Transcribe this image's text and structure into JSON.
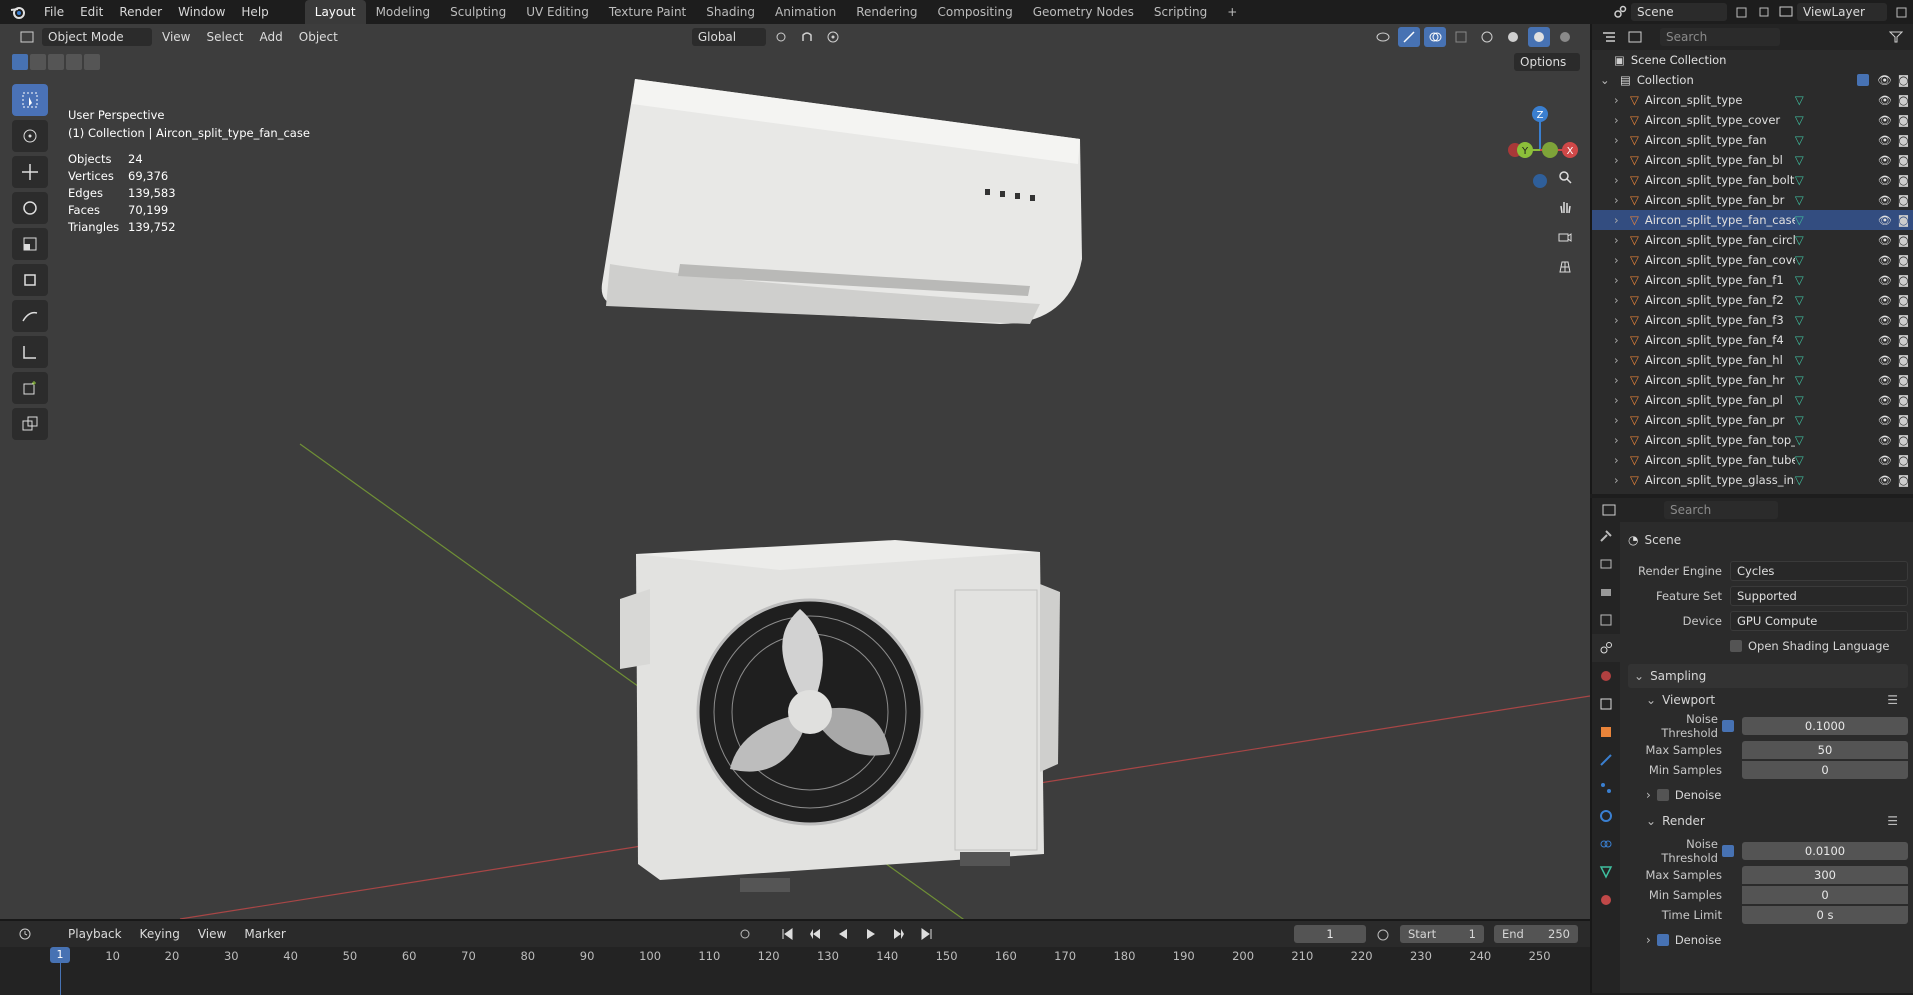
{
  "topbar": {
    "menus": [
      "File",
      "Edit",
      "Render",
      "Window",
      "Help"
    ],
    "workspaces": [
      "Layout",
      "Modeling",
      "Sculpting",
      "UV Editing",
      "Texture Paint",
      "Shading",
      "Animation",
      "Rendering",
      "Compositing",
      "Geometry Nodes",
      "Scripting"
    ],
    "active_workspace": "Layout",
    "add_tab": "+",
    "scene_name": "Scene",
    "view_layer": "ViewLayer"
  },
  "viewport": {
    "mode": "Object Mode",
    "menus": [
      "View",
      "Select",
      "Add",
      "Object"
    ],
    "transform_orientation": "Global",
    "options_label": "Options",
    "overlay_title": "User Perspective",
    "overlay_subtitle": "(1) Collection | Aircon_split_type_fan_case",
    "stats": [
      {
        "label": "Objects",
        "value": "24"
      },
      {
        "label": "Vertices",
        "value": "69,376"
      },
      {
        "label": "Edges",
        "value": "139,583"
      },
      {
        "label": "Faces",
        "value": "70,199"
      },
      {
        "label": "Triangles",
        "value": "139,752"
      }
    ],
    "gizmo": {
      "z": "Z",
      "y": "Y",
      "x": "X"
    }
  },
  "outliner": {
    "search_placeholder": "Search",
    "scene_collection": "Scene Collection",
    "collection": "Collection",
    "objects": [
      "Aircon_split_type",
      "Aircon_split_type_cover",
      "Aircon_split_type_fan",
      "Aircon_split_type_fan_bl",
      "Aircon_split_type_fan_bolts",
      "Aircon_split_type_fan_br",
      "Aircon_split_type_fan_case",
      "Aircon_split_type_fan_circle",
      "Aircon_split_type_fan_cover",
      "Aircon_split_type_fan_f1",
      "Aircon_split_type_fan_f2",
      "Aircon_split_type_fan_f3",
      "Aircon_split_type_fan_f4",
      "Aircon_split_type_fan_hl",
      "Aircon_split_type_fan_hr",
      "Aircon_split_type_fan_pl",
      "Aircon_split_type_fan_pr",
      "Aircon_split_type_fan_top_p",
      "Aircon_split_type_fan_tube",
      "Aircon_split_type_glass_inner"
    ],
    "selected": "Aircon_split_type_fan_case"
  },
  "properties": {
    "search_placeholder": "Search",
    "context": "Scene",
    "render_engine_label": "Render Engine",
    "render_engine": "Cycles",
    "feature_set_label": "Feature Set",
    "feature_set": "Supported",
    "device_label": "Device",
    "device": "GPU Compute",
    "osl_label": "Open Shading Language",
    "sampling": "Sampling",
    "viewport_panel": "Viewport",
    "vp_noise_label": "Noise Threshold",
    "vp_noise": "0.1000",
    "vp_max_label": "Max Samples",
    "vp_max": "50",
    "vp_min_label": "Min Samples",
    "vp_min": "0",
    "vp_denoise": "Denoise",
    "render_panel": "Render",
    "r_noise_label": "Noise Threshold",
    "r_noise": "0.0100",
    "r_max_label": "Max Samples",
    "r_max": "300",
    "r_min_label": "Min Samples",
    "r_min": "0",
    "r_time_label": "Time Limit",
    "r_time": "0 s",
    "r_denoise": "Denoise"
  },
  "timeline": {
    "menus": [
      "Playback",
      "Keying",
      "View",
      "Marker"
    ],
    "current_frame": "1",
    "start_label": "Start",
    "start": "1",
    "end_label": "End",
    "end": "250",
    "ticks": [
      "10",
      "20",
      "30",
      "40",
      "50",
      "60",
      "70",
      "80",
      "90",
      "100",
      "110",
      "120",
      "130",
      "140",
      "150",
      "160",
      "170",
      "180",
      "190",
      "200",
      "210",
      "220",
      "230",
      "240",
      "250"
    ],
    "playhead": "1"
  },
  "colors": {
    "accent": "#4772b3",
    "viewport_bg": "#3d3d3d",
    "panel_bg": "#2b2b2b",
    "mesh_icon": "#e9843a",
    "vertex_icon": "#3fbf9f",
    "x_axis": "#d04848",
    "y_axis": "#8cbf3a",
    "z_axis": "#3a7fd0"
  }
}
